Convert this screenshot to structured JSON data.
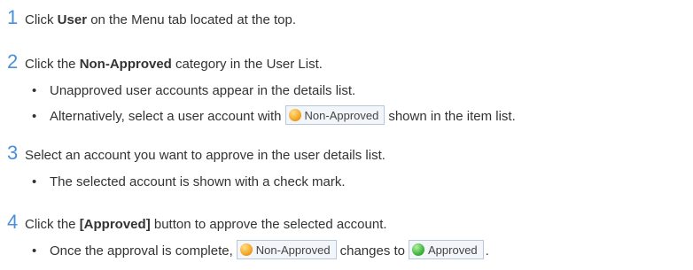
{
  "steps": [
    {
      "num": "1",
      "pre": "Click ",
      "bold": "User",
      "post": " on the Menu tab located at the top."
    },
    {
      "num": "2",
      "pre": "Click the ",
      "bold": "Non-Approved",
      "post": " category in the User List."
    },
    {
      "num": "3",
      "text": "Select an account you want to approve in the user details list."
    },
    {
      "num": "4",
      "pre": "Click the ",
      "bold": "[Approved]",
      "post": " button to approve the selected account."
    }
  ],
  "bullets": {
    "s2_b1": "Unapproved user accounts appear in the details list.",
    "s2_b2_pre": "Alternatively, select a user account with",
    "s2_b2_post": "shown in the item list.",
    "s3_b1": "The selected account is shown with a check mark.",
    "s4_b1_pre": "Once the approval is complete,",
    "s4_b1_mid": "changes to",
    "s4_b1_post": ".",
    "dot": "•"
  },
  "badges": {
    "non_approved": "Non-Approved",
    "approved": "Approved",
    "non_approved_color": "#f5a623",
    "approved_color": "#3fb63f"
  }
}
